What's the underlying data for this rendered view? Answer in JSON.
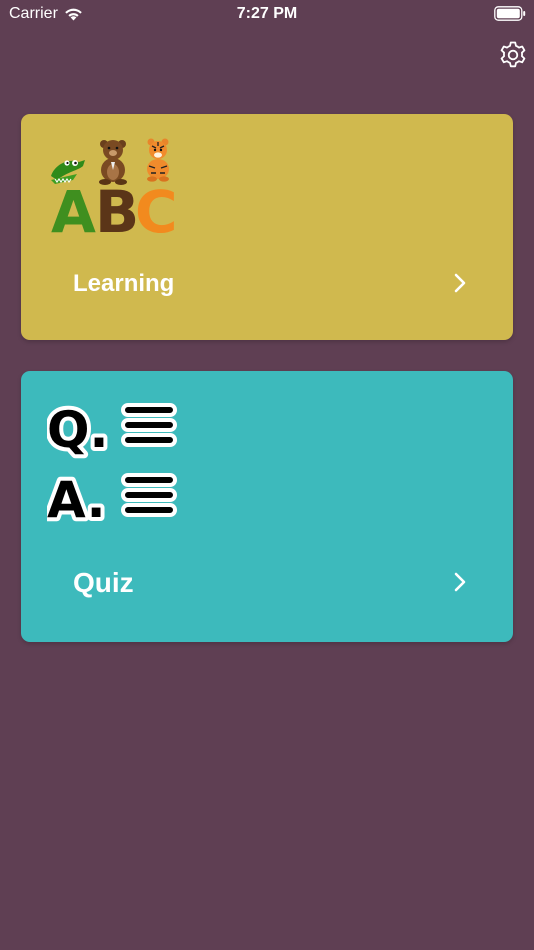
{
  "status_bar": {
    "carrier": "Carrier",
    "time": "7:27 PM",
    "icons": [
      "wifi-icon",
      "battery-icon"
    ]
  },
  "header": {
    "settings_icon": "gear-icon"
  },
  "cards": [
    {
      "label": "Learning",
      "art": "abc-animals-letters",
      "art_letters": [
        "A",
        "B",
        "C"
      ],
      "background": "#d0b94e",
      "icon": "chevron-right-icon"
    },
    {
      "label": "Quiz",
      "art": "q-and-a",
      "art_letters": [
        "Q.",
        "A."
      ],
      "background": "#3dbabc",
      "icon": "chevron-right-icon"
    }
  ],
  "colors": {
    "background": "#5f3f53",
    "text": "#ffffff"
  }
}
